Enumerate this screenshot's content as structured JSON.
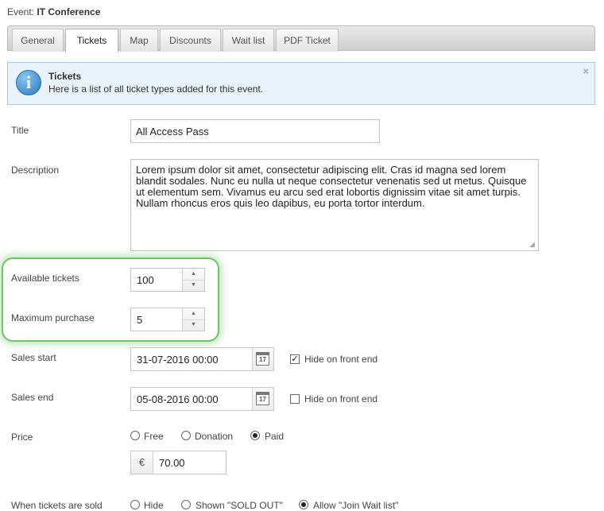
{
  "event": {
    "label": "Event:",
    "name": "IT Conference"
  },
  "tabs": [
    {
      "label": "General"
    },
    {
      "label": "Tickets",
      "active": true
    },
    {
      "label": "Map"
    },
    {
      "label": "Discounts"
    },
    {
      "label": "Wait list"
    },
    {
      "label": "PDF Ticket"
    }
  ],
  "info": {
    "icon": "info-icon",
    "title": "Tickets",
    "text": "Here is a list of all ticket types added for this event.",
    "close": "×"
  },
  "form": {
    "title": {
      "label": "Title",
      "value": "All Access Pass"
    },
    "description": {
      "label": "Description",
      "value": "Lorem ipsum dolor sit amet, consectetur adipiscing elit. Cras id magna sed lorem blandit sodales. Nunc eu nulla ut neque consectetur venenatis sed ut metus. Quisque ut elementum sem. Vivamus eu arcu sed erat lobortis dignissim vitae sit amet turpis. Nullam rhoncus eros quis leo dapibus, eu porta tortor interdum."
    },
    "available_tickets": {
      "label": "Available tickets",
      "value": "100"
    },
    "maximum_purchase": {
      "label": "Maximum purchase",
      "value": "5"
    },
    "sales_start": {
      "label": "Sales start",
      "value": "31-07-2016 00:00",
      "hide_label": "Hide on front end",
      "hide_checked": true
    },
    "sales_end": {
      "label": "Sales end",
      "value": "05-08-2016 00:00",
      "hide_label": "Hide on front end",
      "hide_checked": false
    },
    "calendar_day": "17",
    "price": {
      "label": "Price",
      "options": [
        {
          "label": "Free",
          "checked": false
        },
        {
          "label": "Donation",
          "checked": false
        },
        {
          "label": "Paid",
          "checked": true
        }
      ],
      "currency": "€",
      "value": "70.00"
    },
    "sold_out": {
      "label": "When tickets are sold",
      "options": [
        {
          "label": "Hide",
          "checked": false
        },
        {
          "label": "Shown \"SOLD OUT\"",
          "checked": false
        },
        {
          "label": "Allow \"Join Wait list\"",
          "checked": true
        }
      ]
    }
  },
  "colors": {
    "highlight": "#6cc466",
    "info_bg": "#e8f3fb",
    "info_border": "#a8cbe3"
  }
}
